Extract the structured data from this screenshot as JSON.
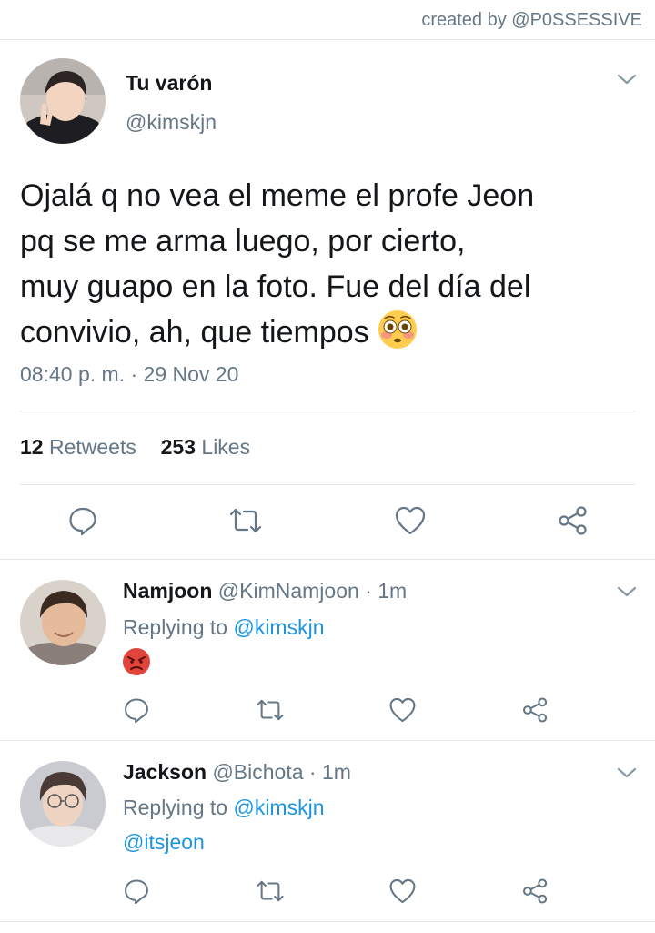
{
  "credit": "created by @P0SSESSIVE",
  "main_tweet": {
    "name": "Tu varón",
    "handle": "@kimskjn",
    "text_lines": [
      "Ojalá q no vea el meme el profe Jeon",
      "pq se me arma luego, por cierto,",
      "muy guapo en la foto. Fue del día del",
      "convivio, ah, que tiempos"
    ],
    "emoji": "flushed-face",
    "time": "08:40 p. m.",
    "separator": "·",
    "date": "29 Nov 20",
    "retweets_count": "12",
    "retweets_label": "Retweets",
    "likes_count": "253",
    "likes_label": "Likes"
  },
  "replies": [
    {
      "name": "Namjoon",
      "handle": "@KimNamjoon",
      "time": "· 1m",
      "replying_label": "Replying to",
      "replying_to": "@kimskjn",
      "content_emoji": "angry-face"
    },
    {
      "name": "Jackson",
      "handle": "@Bichota",
      "time": "· 1m",
      "replying_label": "Replying to",
      "replying_to": "@kimskjn",
      "text": "@itsjeon"
    }
  ],
  "icons": [
    "reply-icon",
    "retweet-icon",
    "like-icon",
    "share-icon",
    "chevron-down-icon"
  ],
  "colors": {
    "text": "#14171a",
    "secondary": "#657786",
    "link": "#1b95e0",
    "divider": "#e1e8ed"
  }
}
